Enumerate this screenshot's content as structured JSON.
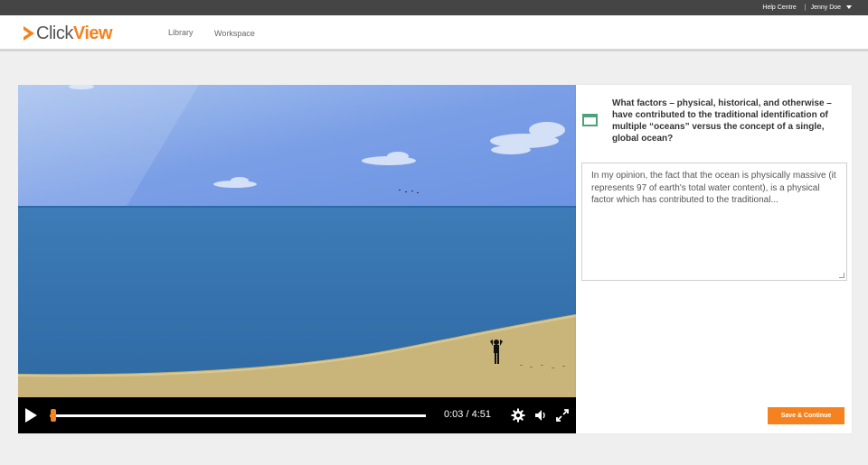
{
  "topbar": {
    "help_label": "Help Centre",
    "separator": "|",
    "user_name": "Jenny Doe"
  },
  "nav": {
    "logo_click": "Click",
    "logo_view": "View",
    "library_label": "Library",
    "workspace_label": "Workspace"
  },
  "player": {
    "current_time": "0:03",
    "duration": "4:51",
    "time_display": "0:03 / 4:51",
    "progress_fraction": 0.0103,
    "controls": [
      "play-icon",
      "gear-icon",
      "volume-icon",
      "fullscreen-icon"
    ]
  },
  "question": {
    "text": "What factors – physical, historical, and otherwise – have contributed to the traditional identification of multiple “oceans” versus the concept of a single, global ocean?",
    "answer_value": "In my opinion, the fact that the ocean is physically massive (it represents 97 of earth's total water content), is a physical factor which has contributed to the traditional...",
    "save_label": "Save & Continue"
  },
  "colors": {
    "accent": "#f5821f",
    "topbar": "#454545",
    "question_icon": "#4ea27a"
  }
}
